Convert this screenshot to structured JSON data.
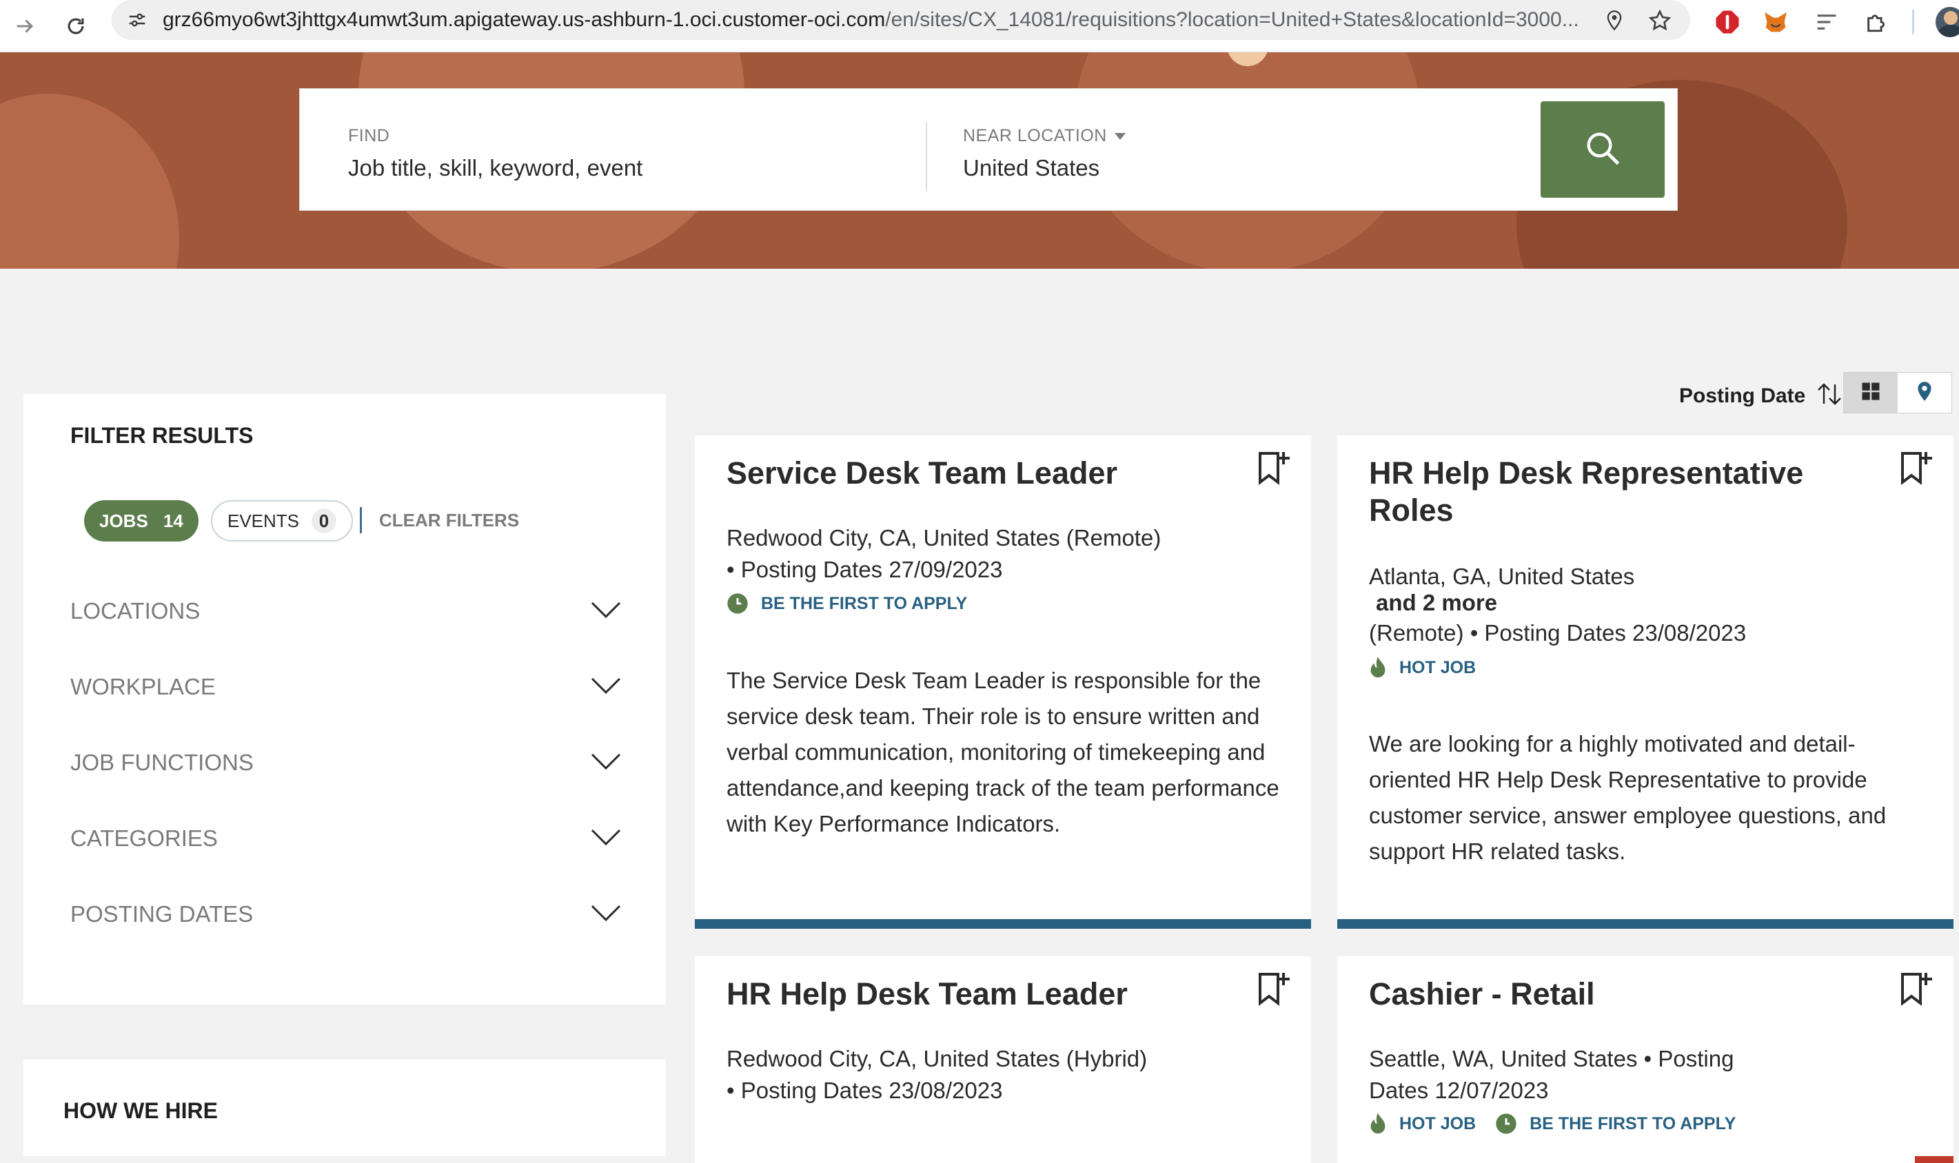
{
  "browser": {
    "url_host": "grz66myo6wt3jhttgx4umwt3um.apigateway.us-ashburn-1.oci.customer-oci.com",
    "url_path": "/en/sites/CX_14081/requisitions?location=United+States&locationId=3000..."
  },
  "search": {
    "find_label": "FIND",
    "find_placeholder": "Job title, skill, keyword, event",
    "location_label": "NEAR LOCATION",
    "location_value": "United States"
  },
  "sort": {
    "label": "Posting Date"
  },
  "filters": {
    "title": "FILTER RESULTS",
    "jobs_label": "JOBS",
    "jobs_count": "14",
    "events_label": "EVENTS",
    "events_count": "0",
    "clear_label": "CLEAR FILTERS",
    "groups": [
      {
        "label": "LOCATIONS"
      },
      {
        "label": "WORKPLACE"
      },
      {
        "label": "JOB FUNCTIONS"
      },
      {
        "label": "CATEGORIES"
      },
      {
        "label": "POSTING DATES"
      }
    ]
  },
  "how_we_hire": {
    "title": "HOW WE HIRE"
  },
  "jobs": [
    {
      "title": "Service Desk Team Leader",
      "location": "Redwood City, CA, United States (Remote)",
      "posting": "• Posting Dates 27/09/2023",
      "badge": "BE THE FIRST TO APPLY",
      "description": "The Service Desk Team Leader is responsible for the service desk team. Their role is to ensure written and verbal communication, monitoring of timekeeping and attendance,and keeping track of the team performance with Key Performance Indicators."
    },
    {
      "title": "HR Help Desk Representative Roles",
      "location": "Atlanta, GA, United States",
      "more": "and 2 more",
      "posting": "(Remote)  • Posting Dates 23/08/2023",
      "badge": "HOT JOB",
      "description": "We are looking for a highly motivated and detail-oriented HR Help Desk Representative to provide customer service, answer employee questions, and support HR related tasks."
    },
    {
      "title": "HR Help Desk Team Leader",
      "location": "Redwood City, CA, United States (Hybrid)",
      "posting": "• Posting Dates 23/08/2023"
    },
    {
      "title": "Cashier - Retail",
      "location": "Seattle, WA, United States  • Posting",
      "posting": "Dates 12/07/2023",
      "badge": "HOT JOB",
      "badge2": "BE THE FIRST TO APPLY"
    }
  ],
  "colors": {
    "hero": "#a0573a",
    "primary_green": "#5c7d4c",
    "accent_blue": "#286081"
  }
}
